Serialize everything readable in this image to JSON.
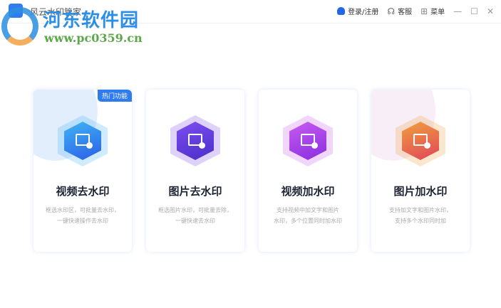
{
  "app": {
    "title": "风云水印管家"
  },
  "watermark": {
    "name": "河东软件园",
    "url": "www.pc0359.cn"
  },
  "header": {
    "login": "登录/注册",
    "service": "客服",
    "menu": "菜单",
    "minimize": "—",
    "maximize": "☐",
    "close": "✕"
  },
  "cards": [
    {
      "title": "视频去水印",
      "badge": "热门功能",
      "desc1": "框选水印区，可批量去水印，",
      "desc2": "一键快速操作去水印",
      "color1": "#3fb5f5",
      "color2": "#2c5ee8",
      "blob": "#e3eefc"
    },
    {
      "title": "图片去水印",
      "desc1": "框选图片水印，可批量去除，",
      "desc2": "一键快速去水印",
      "color1": "#7d4df0",
      "color2": "#4a2fc9",
      "blob": "#ffffff"
    },
    {
      "title": "视频加水印",
      "desc1": "支持视频中加文字和图片",
      "desc2": "水印，多个位置同时加水印",
      "color1": "#c75bf0",
      "color2": "#8a2ee0",
      "blob": "#ffffff"
    },
    {
      "title": "图片加水印",
      "desc1": "支持加文字和图片水印，",
      "desc2": "支持多个水印同时加",
      "color1": "#f0a03c",
      "color2": "#e0455a",
      "blob": "#f7eef8"
    }
  ]
}
